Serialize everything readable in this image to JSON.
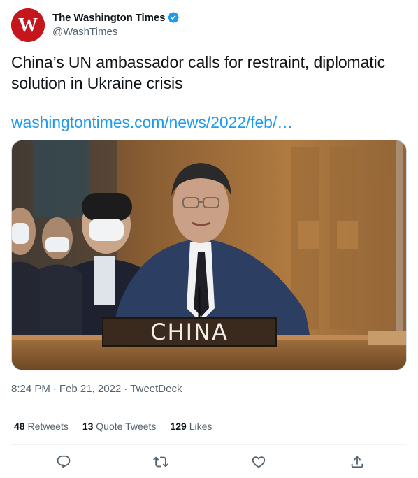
{
  "author": {
    "display_name": "The Washington Times",
    "handle": "@WashTimes",
    "verified": true,
    "avatar_icon": "washington-times-w-logo",
    "avatar_color": "#c4161c",
    "avatar_letter": "W"
  },
  "tweet": {
    "text": "China’s UN ambassador calls for restraint, diplomatic solution in Ukraine crisis",
    "link": "washingtontimes.com/news/2022/feb/…",
    "media": {
      "nameplate_text": "CHINA"
    }
  },
  "meta": {
    "time": "8:24 PM",
    "separator": "·",
    "date": "Feb 21, 2022",
    "source": "TweetDeck"
  },
  "stats": {
    "retweets_count": "48",
    "retweets_label": "Retweets",
    "quotes_count": "13",
    "quotes_label": "Quote Tweets",
    "likes_count": "129",
    "likes_label": "Likes"
  },
  "actions": {
    "reply_icon": "reply-icon",
    "retweet_icon": "retweet-icon",
    "like_icon": "heart-icon",
    "share_icon": "share-icon"
  },
  "colors": {
    "link": "#1d9bf0",
    "secondary_text": "#536471",
    "primary_text": "#0f1419",
    "verified": "#1d9bf0"
  }
}
